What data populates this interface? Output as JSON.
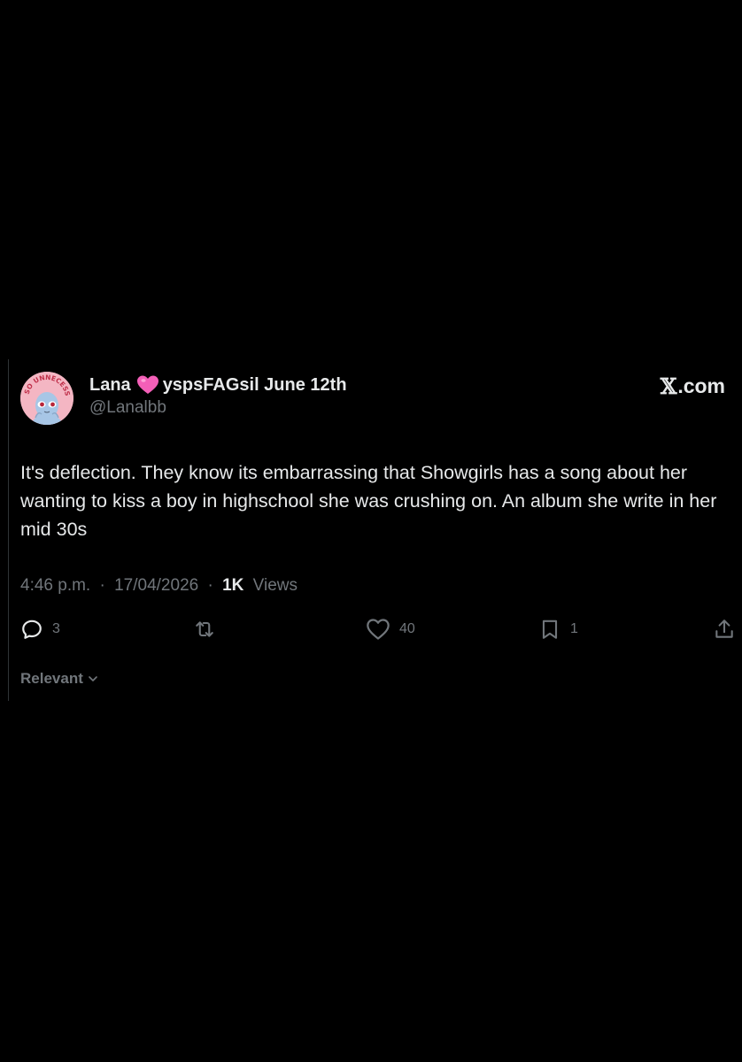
{
  "tweet": {
    "author_name": "Lana",
    "name_suffix": "yspsFAGsil June 12th",
    "handle": "@Lanalbb",
    "avatar_text": "SO UNNECESSARY",
    "brand_x": "𝕏",
    "brand_rest": ".com",
    "text": "It's deflection.  They know its embarrassing that Showgirls has a song about her wanting to kiss a boy in highschool she was crushing on. An album she write in her mid 30s",
    "time": "4:46 p.m.",
    "separator": "·",
    "date": "17/04/2026",
    "views_count": "1K",
    "views_label": "Views",
    "replies": "3",
    "likes": "40",
    "bookmarks": "1",
    "sort_label": "Relevant"
  },
  "colors": {
    "background": "#000000",
    "text_primary": "#e7e9ea",
    "text_secondary": "#71767b",
    "heart": "#f45fb8",
    "avatar_bg": "#f4b6c3",
    "avatar_alien": "#a7c6e6"
  },
  "icons": {
    "reply": "reply-icon",
    "retweet": "retweet-icon",
    "like": "heart-outline-icon",
    "bookmark": "bookmark-icon",
    "share": "share-icon",
    "heart_emoji": "pink-heart-emoji",
    "chevron": "chevron-down-icon"
  }
}
